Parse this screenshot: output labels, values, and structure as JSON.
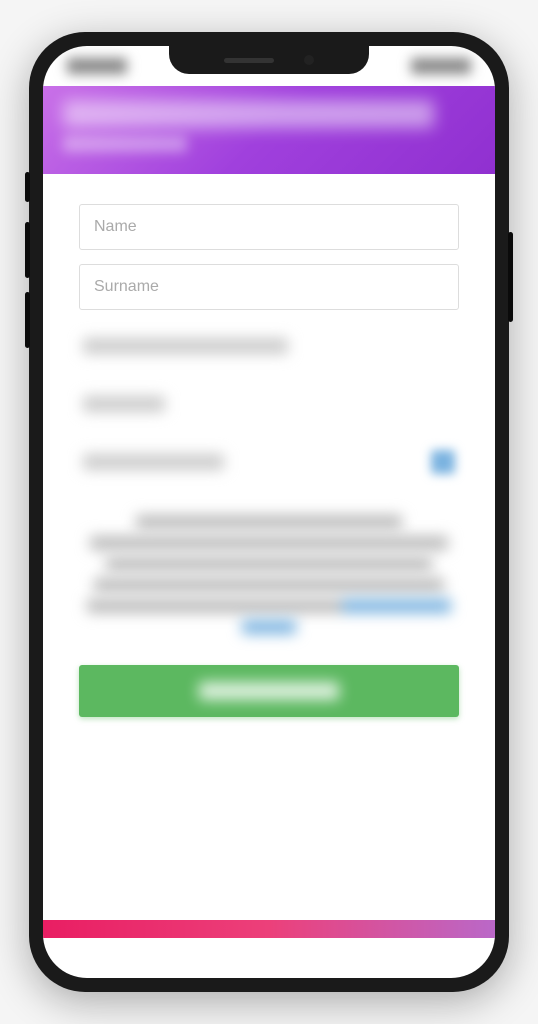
{
  "form": {
    "name_placeholder": "Name",
    "surname_placeholder": "Surname",
    "name_value": "",
    "surname_value": ""
  },
  "colors": {
    "header_gradient_start": "#c970e8",
    "header_gradient_end": "#9030d0",
    "submit_button": "#5cb860",
    "footer_gradient_start": "#e91e63",
    "footer_gradient_end": "#ba68c8"
  }
}
